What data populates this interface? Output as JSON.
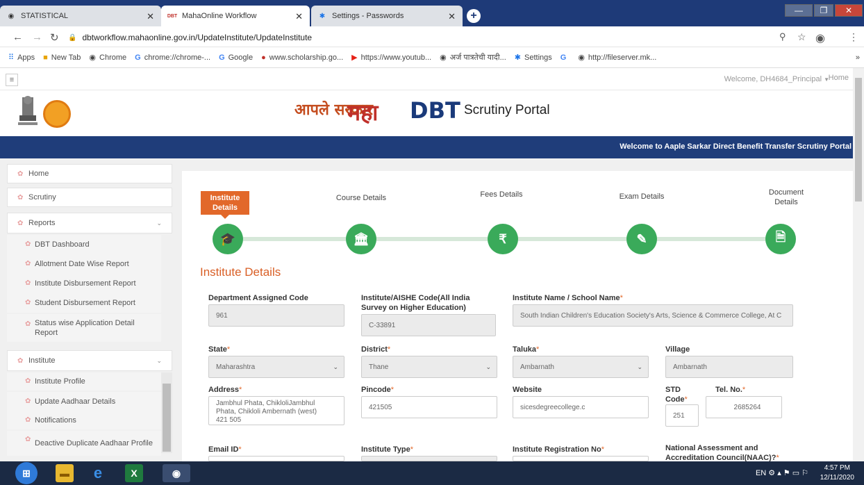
{
  "browser": {
    "tabs": [
      {
        "label": "STATISTICAL",
        "icon": "globe-icon"
      },
      {
        "label": "MahaOnline Workflow",
        "icon": "dbt-logo-icon"
      },
      {
        "label": "Settings - Passwords",
        "icon": "gear-icon"
      }
    ],
    "url": "dbtworkflow.mahaonline.gov.in/UpdateInstitute/UpdateInstitute",
    "bookmarks": [
      "Apps",
      "New Tab",
      "Chrome",
      "chrome://chrome-...",
      "Google",
      "www.scholarship.go...",
      "https://www.youtub...",
      "अर्ज पात्रतेची यादी...",
      "Settings",
      "G",
      "http://fileserver.mk..."
    ],
    "overflow": "»"
  },
  "topbar": {
    "menu_glyph": "≡",
    "welcome": "Welcome, DH4684_Principal",
    "home": "Home"
  },
  "header": {
    "logo_aaple": "आपले सरकार",
    "logo_maha": "महा",
    "logo_dbt": "DBT",
    "portal_title": "Scrutiny Portal",
    "banner": "Welcome to Aaple Sarkar Direct Benefit Transfer Scrutiny Portal"
  },
  "sidebar": {
    "home": "Home",
    "scrutiny": "Scrutiny",
    "reports": "Reports",
    "reports_items": [
      "DBT Dashboard",
      "Allotment Date Wise Report",
      "Institute Disbursement Report",
      "Student Disbursement Report",
      "Status wise Application Detail Report"
    ],
    "institute": "Institute",
    "institute_items": [
      "Institute Profile",
      "Update Aadhaar Details",
      "Notifications",
      "Deactive Duplicate Aadhaar Profile"
    ]
  },
  "wizard": {
    "steps": [
      {
        "label": "Institute Details",
        "icon": "graduation-cap-icon",
        "glyph": "🎓"
      },
      {
        "label": "Course Details",
        "icon": "institution-icon",
        "glyph": "🏛"
      },
      {
        "label": "Fees Details",
        "icon": "rupee-icon",
        "glyph": "₹"
      },
      {
        "label": "Exam Details",
        "icon": "edit-icon",
        "glyph": "✎"
      },
      {
        "label": "Document Details",
        "icon": "document-icon",
        "glyph": "🗎"
      }
    ],
    "active_step": 0
  },
  "form": {
    "section_title": "Institute Details",
    "dept_code_label": "Department Assigned Code",
    "dept_code_value": "961",
    "aishe_label": "Institute/AISHE Code(All India Survey on Higher Education)",
    "aishe_value": "C-33891",
    "inst_name_label": "Institute Name / School Name",
    "inst_name_value": "South Indian Children's Education Society's Arts, Science & Commerce College, At C",
    "state_label": "State",
    "state_value": "Maharashtra",
    "district_label": "District",
    "district_value": "Thane",
    "taluka_label": "Taluka",
    "taluka_value": "Ambarnath",
    "village_label": "Village",
    "village_value": "Ambarnath",
    "address_label": "Address",
    "address_value": "Jambhul Phata, ChikloliJambhul Phata, Chikloli Ambernath (west) 421 505",
    "pincode_label": "Pincode",
    "pincode_value": "421505",
    "website_label": "Website",
    "website_value": "sicesdegreecollege.c",
    "std_label": "STD Code",
    "std_value": "251",
    "tel_label": "Tel. No.",
    "tel_value": "2685264",
    "email_label": "Email ID",
    "insttype_label": "Institute Type",
    "regno_label": "Institute Registration No",
    "naac_label": "National Assessment and Accreditation Council(NAAC)?",
    "required_mark": "*"
  },
  "taskbar": {
    "lang": "EN",
    "time": "4:57 PM",
    "date": "12/11/2020"
  }
}
